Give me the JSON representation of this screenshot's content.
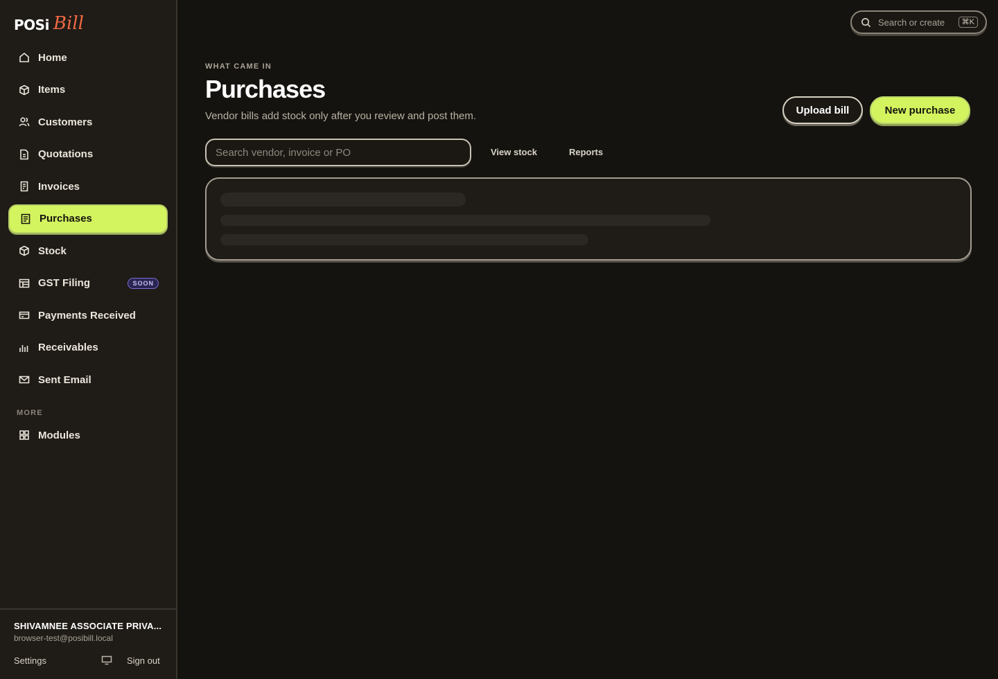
{
  "app": {
    "logo_part1": "POSi",
    "logo_part2": "Bill"
  },
  "sidebar": {
    "items": [
      {
        "label": "Home",
        "icon": "home-icon"
      },
      {
        "label": "Items",
        "icon": "box-icon"
      },
      {
        "label": "Customers",
        "icon": "users-icon"
      },
      {
        "label": "Quotations",
        "icon": "document-icon"
      },
      {
        "label": "Invoices",
        "icon": "receipt-icon"
      },
      {
        "label": "Purchases",
        "icon": "list-document-icon",
        "active": true
      },
      {
        "label": "Stock",
        "icon": "box-icon"
      },
      {
        "label": "GST Filing",
        "icon": "table-icon",
        "badge": "SOON"
      },
      {
        "label": "Payments Received",
        "icon": "card-icon"
      },
      {
        "label": "Receivables",
        "icon": "bars-icon"
      },
      {
        "label": "Sent Email",
        "icon": "mail-icon"
      }
    ],
    "more_label": "MORE",
    "more_items": [
      {
        "label": "Modules",
        "icon": "grid-icon"
      }
    ],
    "footer": {
      "org_name": "SHIVAMNEE ASSOCIATE PRIVA...",
      "email": "browser-test@posibill.local",
      "settings_label": "Settings",
      "signout_label": "Sign out"
    }
  },
  "topbar": {
    "search_placeholder": "Search or create",
    "shortcut": "⌘K"
  },
  "main": {
    "eyebrow": "WHAT CAME IN",
    "title": "Purchases",
    "subtitle": "Vendor bills add stock only after you review and post them.",
    "upload_label": "Upload bill",
    "new_label": "New purchase",
    "search_placeholder": "Search vendor, invoice or PO",
    "view_stock_label": "View stock",
    "reports_label": "Reports"
  },
  "colors": {
    "accent": "#d4f45f",
    "background": "#15130f",
    "sidebar": "#1f1b17",
    "brand_orange": "#f06a43",
    "badge_purple": "#7b6fd6"
  }
}
